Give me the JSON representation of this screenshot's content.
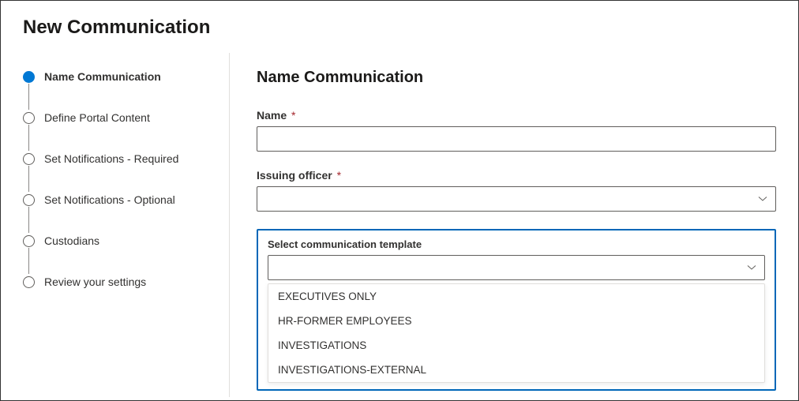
{
  "header": {
    "title": "New Communication"
  },
  "steps": [
    {
      "label": "Name Communication",
      "active": true
    },
    {
      "label": "Define Portal Content",
      "active": false
    },
    {
      "label": "Set Notifications - Required",
      "active": false
    },
    {
      "label": "Set Notifications - Optional",
      "active": false
    },
    {
      "label": "Custodians",
      "active": false
    },
    {
      "label": "Review your settings",
      "active": false
    }
  ],
  "form": {
    "section_title": "Name Communication",
    "name_label": "Name",
    "name_value": "",
    "issuing_officer_label": "Issuing officer",
    "issuing_officer_value": "",
    "template_label": "Select communication template",
    "template_value": "",
    "template_options": [
      "EXECUTIVES ONLY",
      "HR-FORMER EMPLOYEES",
      "INVESTIGATIONS",
      "INVESTIGATIONS-EXTERNAL"
    ]
  }
}
